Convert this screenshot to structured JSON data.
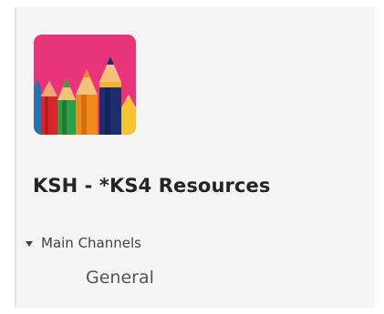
{
  "team": {
    "name": "KSH - *KS4 Resources",
    "avatar_icon": "colored-pencils-icon",
    "avatar_background": "#e8357a"
  },
  "channels": {
    "group_label": "Main Channels",
    "group_icon": "caret-down-icon",
    "items": [
      {
        "label": "General"
      }
    ]
  }
}
